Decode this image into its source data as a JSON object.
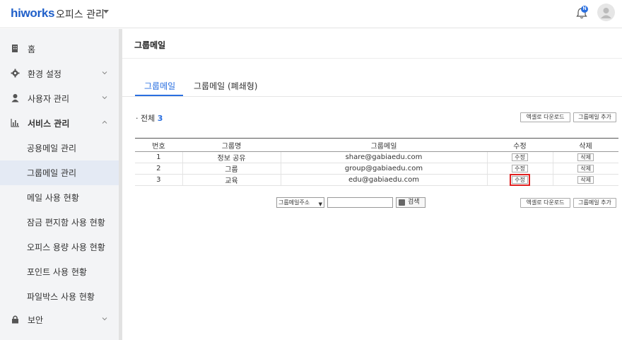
{
  "header": {
    "logo": "hiworks",
    "office_menu": "오피스 관리",
    "notification_badge": "N",
    "accent_color": "#2a6fe0"
  },
  "sidebar": {
    "items": [
      {
        "label": "홈",
        "icon": "building-icon"
      },
      {
        "label": "환경 설정",
        "icon": "gear-icon",
        "expandable": true
      },
      {
        "label": "사용자 관리",
        "icon": "user-icon",
        "expandable": true
      },
      {
        "label": "서비스 관리",
        "icon": "chart-icon",
        "expandable": true,
        "expanded": true
      },
      {
        "label": "보안",
        "icon": "lock-icon",
        "expandable": true
      }
    ],
    "sub_items": [
      {
        "label": "공용메일 관리"
      },
      {
        "label": "그룹메일 관리",
        "active": true
      },
      {
        "label": "메일 사용 현황"
      },
      {
        "label": "잠금 편지함 사용 현황"
      },
      {
        "label": "오피스 용량 사용 현황"
      },
      {
        "label": "포인트 사용 현황"
      },
      {
        "label": "파일박스 사용 현황"
      }
    ]
  },
  "main": {
    "title": "그룹메일",
    "tabs": [
      {
        "label": "그룹메일",
        "active": true
      },
      {
        "label": "그룹메일 (폐쇄형)"
      }
    ],
    "total_label": "· 전체",
    "total_count": "3",
    "excel_download_label": "엑셀로 다운로드",
    "add_group_mail_label": "그룹메일 추가",
    "table": {
      "headers": [
        "번호",
        "그룹명",
        "그룹메일",
        "수정",
        "삭제"
      ],
      "rows": [
        {
          "no": "1",
          "name": "정보 공유",
          "email": "share@gabiaedu.com",
          "edit": "수정",
          "delete": "삭제"
        },
        {
          "no": "2",
          "name": "그룹",
          "email": "group@gabiaedu.com",
          "edit": "수정",
          "delete": "삭제"
        },
        {
          "no": "3",
          "name": "교육",
          "email": "edu@gabiaedu.com",
          "edit": "수정",
          "delete": "삭제"
        }
      ]
    },
    "search": {
      "select_value": "그룹메일주소",
      "input_value": "",
      "button_label": "검색"
    }
  }
}
